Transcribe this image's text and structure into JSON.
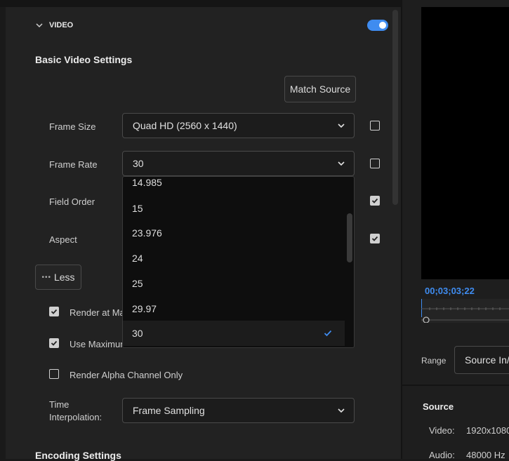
{
  "section": {
    "title": "VIDEO",
    "enabled": true
  },
  "basic_settings": {
    "title": "Basic Video Settings",
    "match_source_label": "Match Source"
  },
  "frame_size": {
    "label": "Frame Size",
    "value": "Quad HD (2560 x 1440)",
    "locked": false
  },
  "frame_rate": {
    "label": "Frame Rate",
    "value": "30",
    "locked": false,
    "options": [
      "14.985",
      "15",
      "23.976",
      "24",
      "25",
      "29.97",
      "30"
    ],
    "selected": "30"
  },
  "field_order": {
    "label": "Field Order",
    "locked": true
  },
  "aspect": {
    "label": "Aspect",
    "locked": true
  },
  "less_button": {
    "label": "Less"
  },
  "render_max": {
    "label": "Render at Max",
    "checked": true
  },
  "use_max": {
    "label": "Use Maximum",
    "checked": true
  },
  "render_alpha": {
    "label": "Render Alpha Channel Only",
    "checked": false
  },
  "time_interp": {
    "label_line1": "Time",
    "label_line2": "Interpolation:",
    "value": "Frame Sampling"
  },
  "encoding": {
    "title": "Encoding Settings"
  },
  "right": {
    "timecode": "00;03;03;22",
    "range_label": "Range",
    "range_value": "Source In/",
    "source_title": "Source",
    "video_key": "Video:",
    "video_val": "1920x1080",
    "audio_key": "Audio:",
    "audio_val": "48000 Hz"
  },
  "colors": {
    "accent": "#3f8cf0",
    "panel": "#222222",
    "dropdown": "#0e0e0e"
  }
}
